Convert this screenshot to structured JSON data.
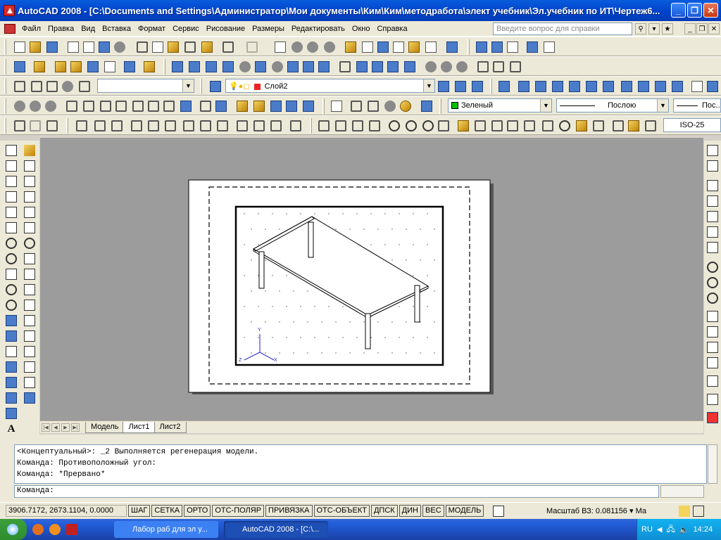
{
  "window": {
    "title": "AutoCAD 2008 - [C:\\Documents and Settings\\Администратор\\Мои документы\\Ким\\Ким\\методработа\\элект учебник\\Эл.учебник по ИТ\\Чертеж6..."
  },
  "menu": {
    "items": [
      "Файл",
      "Правка",
      "Вид",
      "Вставка",
      "Формат",
      "Сервис",
      "Рисование",
      "Размеры",
      "Редактировать",
      "Окно",
      "Справка"
    ],
    "help_placeholder": "Введите вопрос для справки"
  },
  "toolbars": {
    "layer": "Слой2",
    "color": "Зеленый",
    "linetype": "Послою",
    "lineweight": "Пос...",
    "dimstyle": "ISO-25"
  },
  "layout_tabs": [
    "Модель",
    "Лист1",
    "Лист2"
  ],
  "active_tab": "Лист1",
  "ucs_labels": {
    "y": "Y",
    "x": "X",
    "z": "Z"
  },
  "command": {
    "history": [
      "<Концептуальный>: _2 Выполняется регенерация модели.",
      "Команда: Противоположный угол:",
      "Команда: *Прервано*"
    ],
    "prompt": "Команда:"
  },
  "status": {
    "coords": "3906.7172, 2673.1104, 0.0000",
    "toggles": [
      "ШАГ",
      "СЕТКА",
      "ОРТО",
      "ОТС-ПОЛЯР",
      "ПРИВЯЗКА",
      "ОТС-ОБЪЕКТ",
      "ДПСК",
      "ДИН",
      "ВЕС",
      "МОДЕЛЬ"
    ],
    "scale_label": "Масштаб ВЗ:",
    "scale_value": "0.081156",
    "extra": "Ма"
  },
  "taskbar": {
    "tasks": [
      "Лабор  раб для эл у...",
      "AutoCAD 2008 - [C:\\..."
    ],
    "lang": "RU",
    "clock": "14:24"
  },
  "colors": {
    "accent": "#0a5ddd",
    "background": "#9c9c9c",
    "layer_color": "#00c000",
    "stroke": "#000000"
  }
}
